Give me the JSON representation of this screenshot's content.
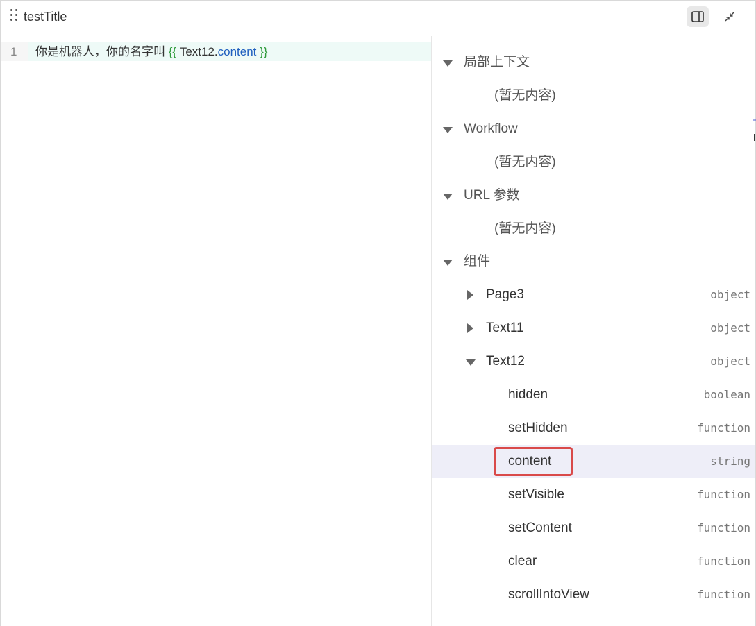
{
  "header": {
    "title": "testTitle",
    "panel_button_icon": "sidebar-panel-icon",
    "collapse_button_icon": "collapse-arrows-icon"
  },
  "editor": {
    "line_number": "1",
    "code_text": "你是机器人，你的名字叫 ",
    "template_open": "{{ ",
    "template_object": "Text12.",
    "template_property": "content",
    "template_close": " }}"
  },
  "panel": {
    "sections": [
      {
        "label": "局部上下文",
        "empty": "(暂无内容)"
      },
      {
        "label": "Workflow",
        "empty": "(暂无内容)"
      },
      {
        "label": "URL 参数",
        "empty": "(暂无内容)"
      },
      {
        "label": "组件"
      }
    ],
    "components": [
      {
        "label": "Page3",
        "type": "object",
        "expanded": false
      },
      {
        "label": "Text11",
        "type": "object",
        "expanded": false
      },
      {
        "label": "Text12",
        "type": "object",
        "expanded": true
      }
    ],
    "text12_props": [
      {
        "label": "hidden",
        "type": "boolean"
      },
      {
        "label": "setHidden",
        "type": "function"
      },
      {
        "label": "content",
        "type": "string",
        "selected": true
      },
      {
        "label": "setVisible",
        "type": "function"
      },
      {
        "label": "setContent",
        "type": "function"
      },
      {
        "label": "clear",
        "type": "function"
      },
      {
        "label": "scrollIntoView",
        "type": "function"
      }
    ]
  },
  "colors": {
    "selected_row": "#eeeef8",
    "highlight_border": "#d94a4a",
    "template_brace": "#2e9a3a",
    "template_property": "#1f5fbf"
  }
}
